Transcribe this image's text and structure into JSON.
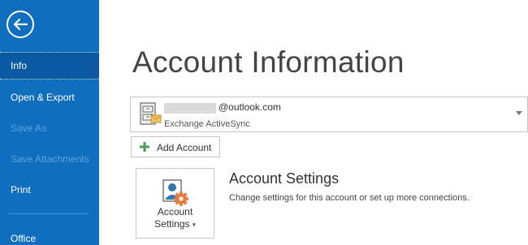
{
  "sidebar": {
    "items": [
      {
        "label": "Info",
        "active": true,
        "enabled": true
      },
      {
        "label": "Open & Export",
        "active": false,
        "enabled": true
      },
      {
        "label": "Save As",
        "active": false,
        "enabled": false
      },
      {
        "label": "Save Attachments",
        "active": false,
        "enabled": false
      },
      {
        "label": "Print",
        "active": false,
        "enabled": true
      },
      {
        "label": "Office",
        "active": false,
        "enabled": true
      }
    ],
    "back_icon": "back-arrow-icon"
  },
  "main": {
    "title": "Account Information",
    "account": {
      "email_visible": "@outlook.com",
      "type": "Exchange ActiveSync",
      "icon": "email-account-icon"
    },
    "add_account_label": "Add Account",
    "settings_button": {
      "line1": "Account",
      "line2": "Settings",
      "icon": "account-settings-icon"
    },
    "settings_section": {
      "title": "Account Settings",
      "description": "Change settings for this account or set up more connections."
    }
  },
  "colors": {
    "sidebar": "#106ebe",
    "sidebar_active": "#0a5aa3",
    "disabled_text": "#5ea3dc"
  }
}
